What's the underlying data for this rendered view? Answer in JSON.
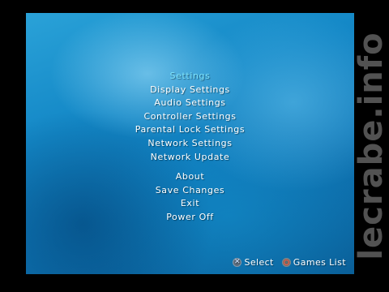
{
  "menu": {
    "items": [
      {
        "label": "Settings",
        "active": true
      },
      {
        "label": "Display Settings"
      },
      {
        "label": "Audio Settings"
      },
      {
        "label": "Controller Settings"
      },
      {
        "label": "Parental Lock Settings"
      },
      {
        "label": "Network Settings"
      },
      {
        "label": "Network Update"
      },
      {
        "label": "About"
      },
      {
        "label": "Save Changes"
      },
      {
        "label": "Exit"
      },
      {
        "label": "Power Off"
      }
    ]
  },
  "hints": {
    "select_icon": "cross-icon",
    "select_label": "Select",
    "games_icon": "circle-icon",
    "games_label": "Games List"
  },
  "watermark": "lecrabe.info",
  "colors": {
    "highlight": "#7fe6ff",
    "text": "#ffffff",
    "background": "#1387c6"
  }
}
